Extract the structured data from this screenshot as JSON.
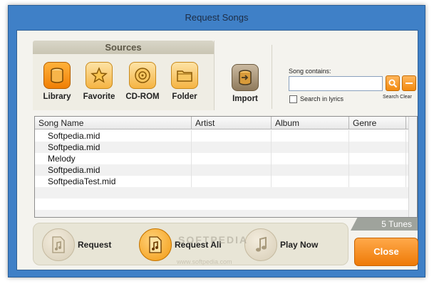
{
  "window": {
    "title": "Request Songs"
  },
  "sources": {
    "header": "Sources",
    "items": [
      {
        "label": "Library",
        "icon": "library-icon"
      },
      {
        "label": "Favorite",
        "icon": "star-icon"
      },
      {
        "label": "CD-ROM",
        "icon": "cdrom-icon"
      },
      {
        "label": "Folder",
        "icon": "folder-icon"
      }
    ],
    "import": {
      "label": "Import",
      "icon": "import-icon"
    }
  },
  "search": {
    "caption": "Song contains:",
    "value": "",
    "placeholder": "",
    "search_label": "Search",
    "clear_label": "Clear",
    "lyrics_label": "Search in lyrics",
    "lyrics_checked": false
  },
  "table": {
    "columns": [
      "Song Name",
      "Artist",
      "Album",
      "Genre"
    ],
    "rows": [
      {
        "song": "Softpedia.mid",
        "artist": "",
        "album": "",
        "genre": ""
      },
      {
        "song": "Softpedia.mid",
        "artist": "",
        "album": "",
        "genre": ""
      },
      {
        "song": "Melody",
        "artist": "",
        "album": "",
        "genre": ""
      },
      {
        "song": "Softpedia.mid",
        "artist": "",
        "album": "",
        "genre": ""
      },
      {
        "song": "SoftpediaTest.mid",
        "artist": "",
        "album": "",
        "genre": ""
      }
    ]
  },
  "status": {
    "tunes": "5 Tunes"
  },
  "actions": {
    "request": "Request",
    "request_all": "Request All",
    "play_now": "Play Now",
    "close": "Close"
  },
  "watermark": {
    "text": "www.softpedia.com",
    "brand": "SOFTPEDIA"
  },
  "colors": {
    "accent": "#f28a10",
    "frame": "#3f80c7"
  }
}
